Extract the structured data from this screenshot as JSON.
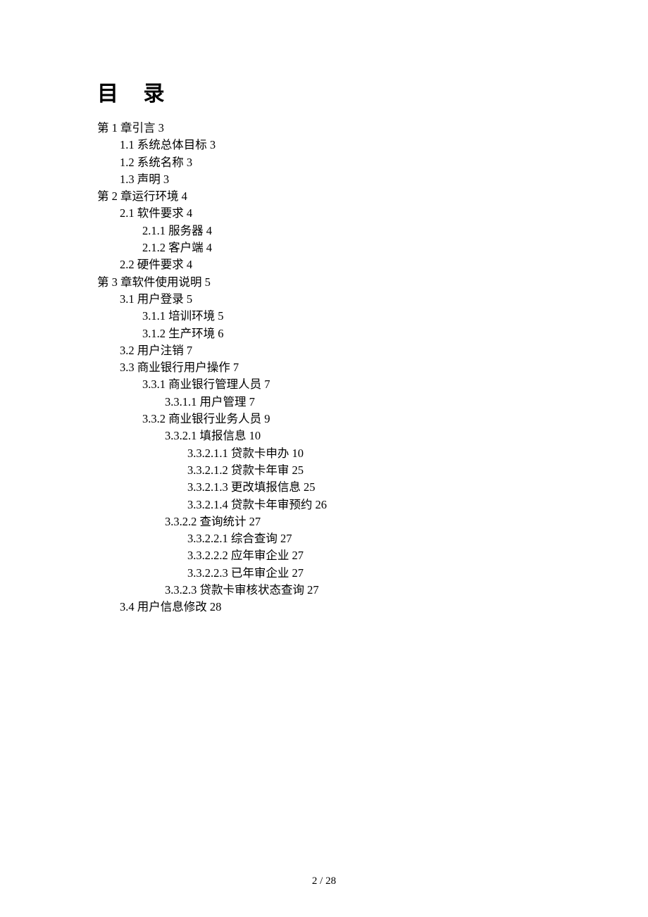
{
  "title": "目 录",
  "entries": [
    {
      "level": "l0",
      "text": "第 1 章引言 3"
    },
    {
      "level": "l1",
      "text": "1.1 系统总体目标 3"
    },
    {
      "level": "l1",
      "text": "1.2 系统名称 3"
    },
    {
      "level": "l1",
      "text": "1.3 声明 3"
    },
    {
      "level": "l0",
      "text": "第 2 章运行环境 4"
    },
    {
      "level": "l1",
      "text": "2.1 软件要求 4"
    },
    {
      "level": "l2",
      "text": "2.1.1 服务器 4"
    },
    {
      "level": "l2",
      "text": "2.1.2 客户端 4"
    },
    {
      "level": "l1",
      "text": "2.2 硬件要求 4"
    },
    {
      "level": "l0",
      "text": "第 3 章软件使用说明 5"
    },
    {
      "level": "l1",
      "text": "3.1 用户登录 5"
    },
    {
      "level": "l2",
      "text": "3.1.1 培训环境 5"
    },
    {
      "level": "l2",
      "text": "3.1.2 生产环境 6"
    },
    {
      "level": "l1",
      "text": "3.2 用户注销 7"
    },
    {
      "level": "l1",
      "text": "3.3 商业银行用户操作 7"
    },
    {
      "level": "l2",
      "text": "3.3.1 商业银行管理人员 7"
    },
    {
      "level": "l3",
      "text": "3.3.1.1 用户管理 7"
    },
    {
      "level": "l2",
      "text": "3.3.2 商业银行业务人员 9"
    },
    {
      "level": "l3",
      "text": "3.3.2.1 填报信息 10"
    },
    {
      "level": "l4",
      "text": "3.3.2.1.1 贷款卡申办 10"
    },
    {
      "level": "l4",
      "text": "3.3.2.1.2 贷款卡年审 25"
    },
    {
      "level": "l4",
      "text": "3.3.2.1.3 更改填报信息 25"
    },
    {
      "level": "l4",
      "text": "3.3.2.1.4 贷款卡年审预约 26"
    },
    {
      "level": "l3",
      "text": "3.3.2.2 查询统计 27"
    },
    {
      "level": "l4",
      "text": "3.3.2.2.1 综合查询 27"
    },
    {
      "level": "l4",
      "text": "3.3.2.2.2 应年审企业 27"
    },
    {
      "level": "l4",
      "text": "3.3.2.2.3 已年审企业 27"
    },
    {
      "level": "l3",
      "text": "3.3.2.3 贷款卡审核状态查询 27"
    },
    {
      "level": "l1",
      "text": "3.4 用户信息修改 28"
    }
  ],
  "pageNumber": "2 / 28"
}
